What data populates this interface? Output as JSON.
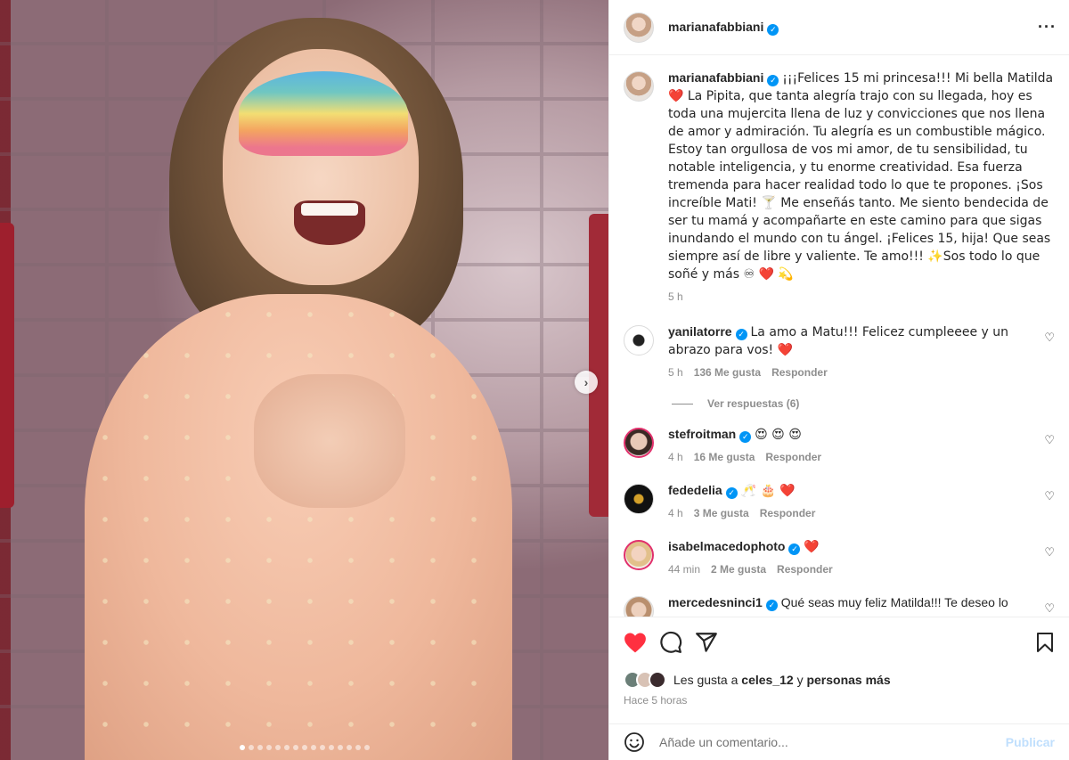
{
  "header": {
    "username": "marianafabbiani"
  },
  "caption": {
    "username": "marianafabbiani",
    "text": "¡¡¡Felices 15 mi princesa!!! Mi bella Matilda ❤️ La Pipita, que tanta alegría trajo con su llegada, hoy es toda una mujercita llena de luz y convicciones que nos llena de amor y admiración. Tu alegría es un combustible mágico. Estoy tan orgullosa de vos mi amor, de tu sensibilidad, tu notable inteligencia, y tu enorme creatividad. Esa fuerza tremenda para hacer realidad todo lo que te propones. ¡Sos increíble Mati! 🍸 Me enseñás tanto. Me siento bendecida de ser tu mamá y acompañarte en este camino para que sigas inundando el mundo con tu ángel. ¡Felices 15, hija! Que seas siempre así de libre y valiente. Te amo!!! ✨Sos todo lo que soñé y más ♾ ❤️ 💫",
    "time": "5 h"
  },
  "comments": [
    {
      "username": "yanilatorre",
      "text": "La amo a Matu!!! Felicez cumpleeee y un abrazo para vos! ❤️",
      "time": "5 h",
      "likes": "136 Me gusta",
      "reply": "Responder"
    },
    {
      "username": "stefroitman",
      "text": "😍 😍 😍",
      "time": "4 h",
      "likes": "16 Me gusta",
      "reply": "Responder"
    },
    {
      "username": "fededelia",
      "text": "🥂 🎂 ❤️",
      "time": "4 h",
      "likes": "3 Me gusta",
      "reply": "Responder"
    },
    {
      "username": "isabelmacedophoto",
      "text": "❤️",
      "time": "44 min",
      "likes": "2 Me gusta",
      "reply": "Responder"
    },
    {
      "username": "mercedesninci1",
      "text": "Qué seas muy feliz Matilda!!! Te deseo lo"
    }
  ],
  "view_replies": "Ver respuestas (6)",
  "likes_summary": {
    "prefix": "Les gusta a",
    "user": "celes_12",
    "connector": "y",
    "suffix": "personas más"
  },
  "posted_time": "Hace 5 horas",
  "comment_box": {
    "placeholder": "Añade un comentario...",
    "publish": "Publicar"
  },
  "carousel": {
    "count": 15,
    "active_index": 0
  }
}
